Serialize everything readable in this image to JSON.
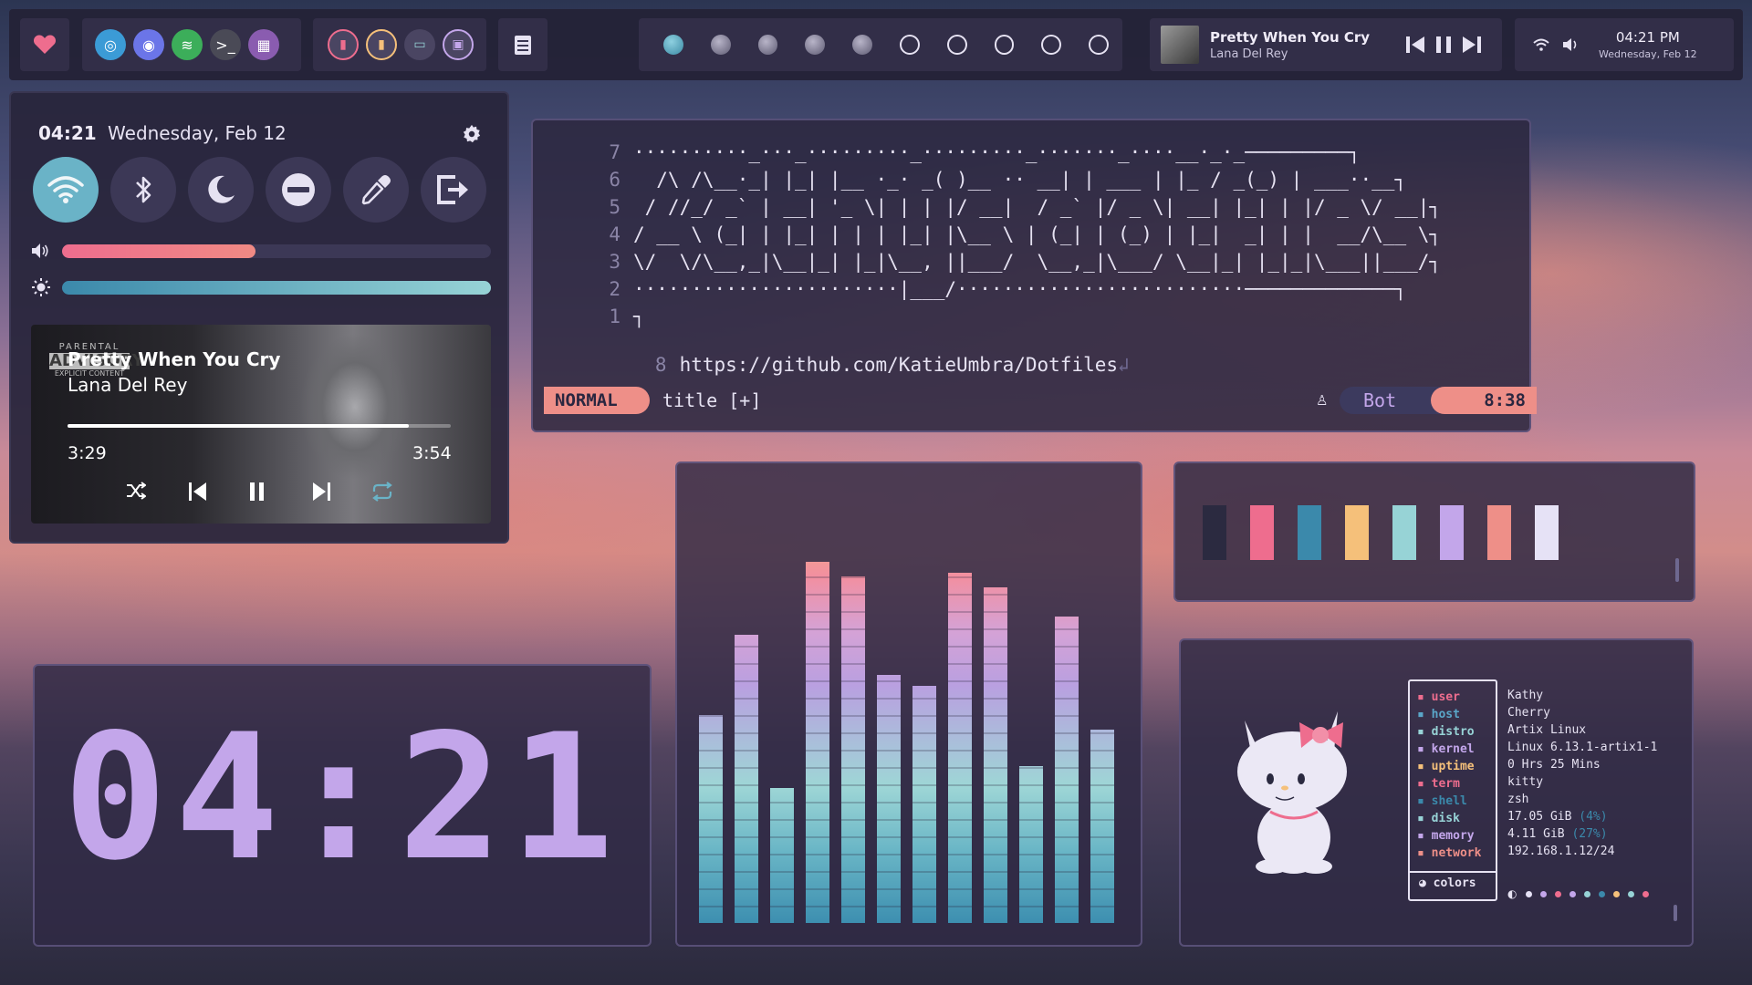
{
  "topbar": {
    "favorite_icon": "heart-icon",
    "apps": [
      {
        "name": "browser-icon",
        "color": "#3b9bd6",
        "glyph": "◎"
      },
      {
        "name": "discord-icon",
        "color": "#6b75e8",
        "glyph": "◉"
      },
      {
        "name": "spotify-icon",
        "color": "#3cae5a",
        "glyph": "≋"
      },
      {
        "name": "terminal-icon",
        "color": "#4a4a56",
        "glyph": ">_"
      },
      {
        "name": "app-grid-icon",
        "color": "#8a5cb0",
        "glyph": "▦"
      }
    ],
    "workspaces": [
      "active",
      "filled",
      "filled",
      "filled",
      "filled",
      "empty",
      "empty",
      "empty",
      "empty",
      "empty"
    ],
    "media": {
      "title": "Pretty When You Cry",
      "artist": "Lana Del Rey"
    },
    "clock": {
      "time": "04:21 PM",
      "date": "Wednesday, Feb 12"
    }
  },
  "control_center": {
    "time": "04:21",
    "date": "Wednesday, Feb 12",
    "volume_percent": 45,
    "brightness_percent": 100,
    "toggles": [
      "wifi",
      "bluetooth",
      "night-light",
      "do-not-disturb",
      "color-picker",
      "logout"
    ]
  },
  "player": {
    "explicit_line1": "PARENTAL",
    "explicit_line2": "ADVISORY",
    "explicit_line3": "EXPLICIT CONTENT",
    "title": "Pretty When You Cry",
    "artist": "Lana Del Rey",
    "elapsed": "3:29",
    "duration": "3:54",
    "progress_fraction": 0.89
  },
  "terminal": {
    "line_numbers": [
      "7",
      "6",
      "5",
      "4",
      "3",
      "2",
      "1"
    ],
    "ascii_lines": [
      "··········_···_·········_·········_·······_····__·_·_─────────┐",
      "  /\\ /\\__·_| |_| |__ ·_· _( )__ ·· __| | ___ | |_ / _(_) | ___··__┐",
      " / //_/ _` | __| '_ \\| | | |/ __|  / _` |/ _ \\| __| |_| | |/ _ \\/ __|┐",
      "/ __ \\ (_| | |_| | | | |_| |\\__ \\ | (_| | (_) | |_|  _| | |  __/\\__ \\┐",
      "\\/  \\/\\__,_|\\__|_| |_|\\__, ||___/  \\__,_|\\___/ \\__|_| |_|_|\\___||___/┐",
      "·······················|___/·························─────────────┐",
      "┐"
    ],
    "url_line_number": "8",
    "url": "https://github.com/KatieUmbra/Dotfiles",
    "mode": "NORMAL",
    "filename": "title [+]",
    "position": "Bot",
    "cursor": "8:38"
  },
  "clock_widget": {
    "time": "04:21"
  },
  "visualizer": {
    "levels": [
      0.57,
      0.79,
      0.37,
      0.99,
      0.95,
      0.68,
      0.65,
      0.96,
      0.92,
      0.43,
      0.84,
      0.53
    ]
  },
  "palette": {
    "swatches": [
      "#2b2a40",
      "#ee6d8e",
      "#3b89ab",
      "#f5c07a",
      "#97d3d6",
      "#c3a6ea",
      "#ee8f88",
      "#e6e2f6"
    ]
  },
  "fetch": {
    "rows": [
      {
        "icon": "user-icon",
        "key": "user",
        "value": "Kathy",
        "color": "#ee6d8e"
      },
      {
        "icon": "host-icon",
        "key": "host",
        "value": "Cherry",
        "color": "#5aa6c8"
      },
      {
        "icon": "distro-icon",
        "key": "distro",
        "value": "Artix Linux",
        "color": "#97d3d6"
      },
      {
        "icon": "kernel-icon",
        "key": "kernel",
        "value": "Linux 6.13.1-artix1-1",
        "color": "#c3a6ea"
      },
      {
        "icon": "uptime-icon",
        "key": "uptime",
        "value": "0 Hrs 25 Mins",
        "color": "#f5c07a"
      },
      {
        "icon": "term-icon",
        "key": "term",
        "value": "kitty",
        "color": "#ee6d8e"
      },
      {
        "icon": "shell-icon",
        "key": "shell",
        "value": "zsh",
        "color": "#3b89ab"
      },
      {
        "icon": "disk-icon",
        "key": "disk",
        "value": "17.05 GiB",
        "extra": "(4%)",
        "color": "#97d3d6"
      },
      {
        "icon": "memory-icon",
        "key": "memory",
        "value": "4.11 GiB",
        "extra": "(27%)",
        "color": "#c3a6ea"
      },
      {
        "icon": "network-icon",
        "key": "network",
        "value": "192.168.1.12/24",
        "color": "#ee8f88"
      }
    ],
    "colors_label": "colors",
    "color_dots": [
      "#e6e2f6",
      "#c3a6ea",
      "#ee6d8e",
      "#c3a6ea",
      "#97d3d6",
      "#3b89ab",
      "#f5c07a",
      "#97d3d6",
      "#ee6d8e"
    ]
  }
}
